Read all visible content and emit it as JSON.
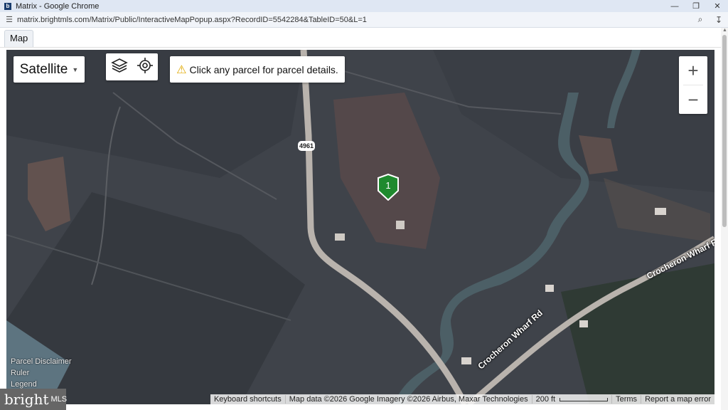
{
  "window": {
    "title": "Matrix - Google Chrome",
    "app_icon": "b",
    "controls": [
      "minimize-icon",
      "restore-icon",
      "close-icon"
    ]
  },
  "address_bar": {
    "url": "matrix.brightmls.com/Matrix/Public/InteractiveMapPopup.aspx?RecordID=5542284&TableID=50&L=1"
  },
  "page": {
    "tab_label": "Map"
  },
  "map": {
    "map_type": "Satellite",
    "notice": "Click any parcel for parcel details.",
    "zoom_in": "+",
    "zoom_out": "−",
    "marker_label": "1",
    "marker_color": "#1f8a2e",
    "route_shield": "4961",
    "road_labels": [
      "Crocheron Wharf Rd",
      "Crocheron Wharf Rd"
    ],
    "side_links": [
      "Parcel Disclaimer",
      "Ruler",
      "Legend"
    ],
    "attribution": {
      "keyboard": "Keyboard shortcuts",
      "data": "Map data ©2026 Google Imagery ©2026 Airbus, Maxar Technologies",
      "scale": "200 ft",
      "terms": "Terms",
      "report": "Report a map error"
    }
  },
  "logo": {
    "text": "bright",
    "suffix": "MLS"
  }
}
